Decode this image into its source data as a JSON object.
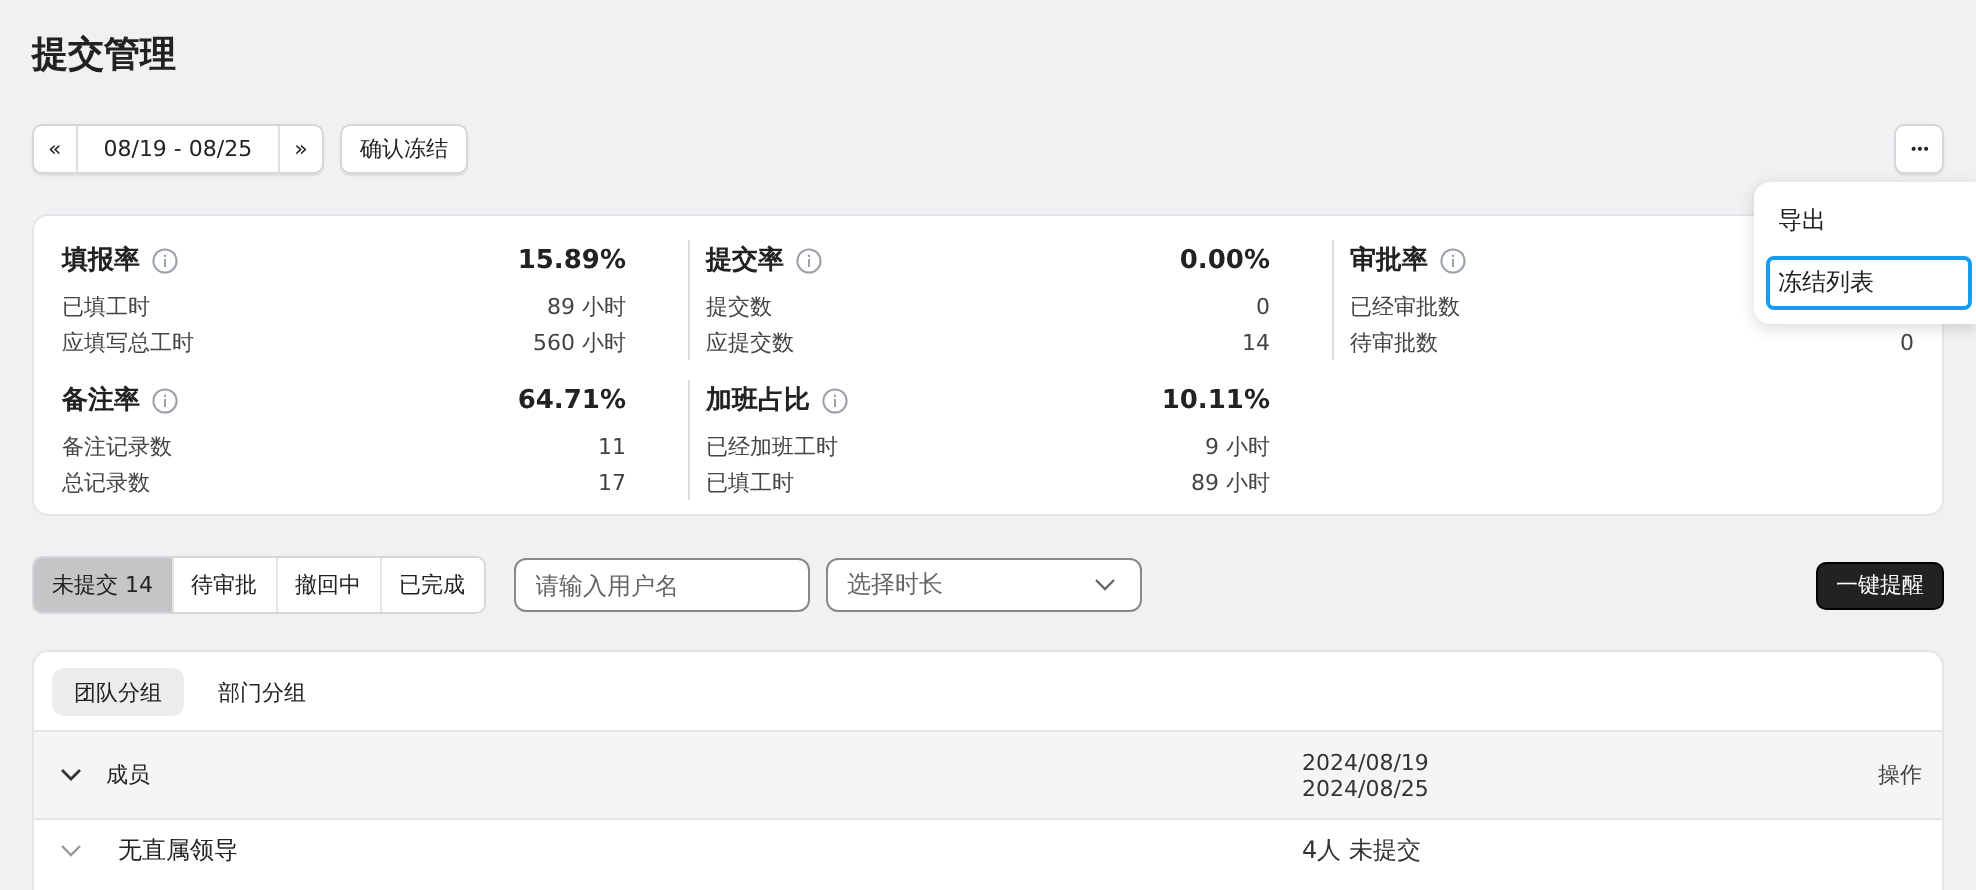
{
  "title": "提交管理",
  "toolbar": {
    "prev": "«",
    "range": "08/19 - 08/25",
    "next": "»",
    "confirm": "确认冻结",
    "more": "•••"
  },
  "menu": [
    {
      "label": "导出",
      "selected": false
    },
    {
      "label": "冻结列表",
      "selected": true
    }
  ],
  "stats": [
    [
      {
        "title": "填报率",
        "value": "15.89%",
        "rows": [
          {
            "label": "已填工时",
            "value": "89 小时"
          },
          {
            "label": "应填写总工时",
            "value": "560 小时"
          }
        ]
      },
      {
        "title": "备注率",
        "value": "64.71%",
        "rows": [
          {
            "label": "备注记录数",
            "value": "11"
          },
          {
            "label": "总记录数",
            "value": "17"
          }
        ]
      }
    ],
    [
      {
        "title": "提交率",
        "value": "0.00%",
        "rows": [
          {
            "label": "提交数",
            "value": "0"
          },
          {
            "label": "应提交数",
            "value": "14"
          }
        ]
      },
      {
        "title": "加班占比",
        "value": "10.11%",
        "rows": [
          {
            "label": "已经加班工时",
            "value": "9 小时"
          },
          {
            "label": "已填工时",
            "value": "89 小时"
          }
        ]
      }
    ],
    [
      {
        "title": "审批率",
        "rows": [
          {
            "label": "已经审批数"
          },
          {
            "label": "待审批数",
            "value": "0"
          }
        ]
      }
    ]
  ],
  "status_tabs": [
    {
      "label": "未提交 14",
      "selected": true
    },
    {
      "label": "待审批",
      "selected": false
    },
    {
      "label": "撤回中",
      "selected": false
    },
    {
      "label": "已完成",
      "selected": false
    }
  ],
  "search": {
    "placeholder": "请输入用户名"
  },
  "duration": {
    "placeholder": "选择时长"
  },
  "remind_button": "一键提醒",
  "group_tabs": [
    {
      "label": "团队分组",
      "selected": true
    },
    {
      "label": "部门分组",
      "selected": false
    }
  ],
  "table": {
    "columns": [
      {
        "label": "成员"
      },
      {
        "label": "2024/08/19",
        "label2": "2024/08/25"
      },
      {
        "label": "操作"
      }
    ],
    "rows": [
      {
        "expanded": true,
        "cells": [
          "无直属领导",
          "4人 未提交"
        ]
      }
    ]
  }
}
